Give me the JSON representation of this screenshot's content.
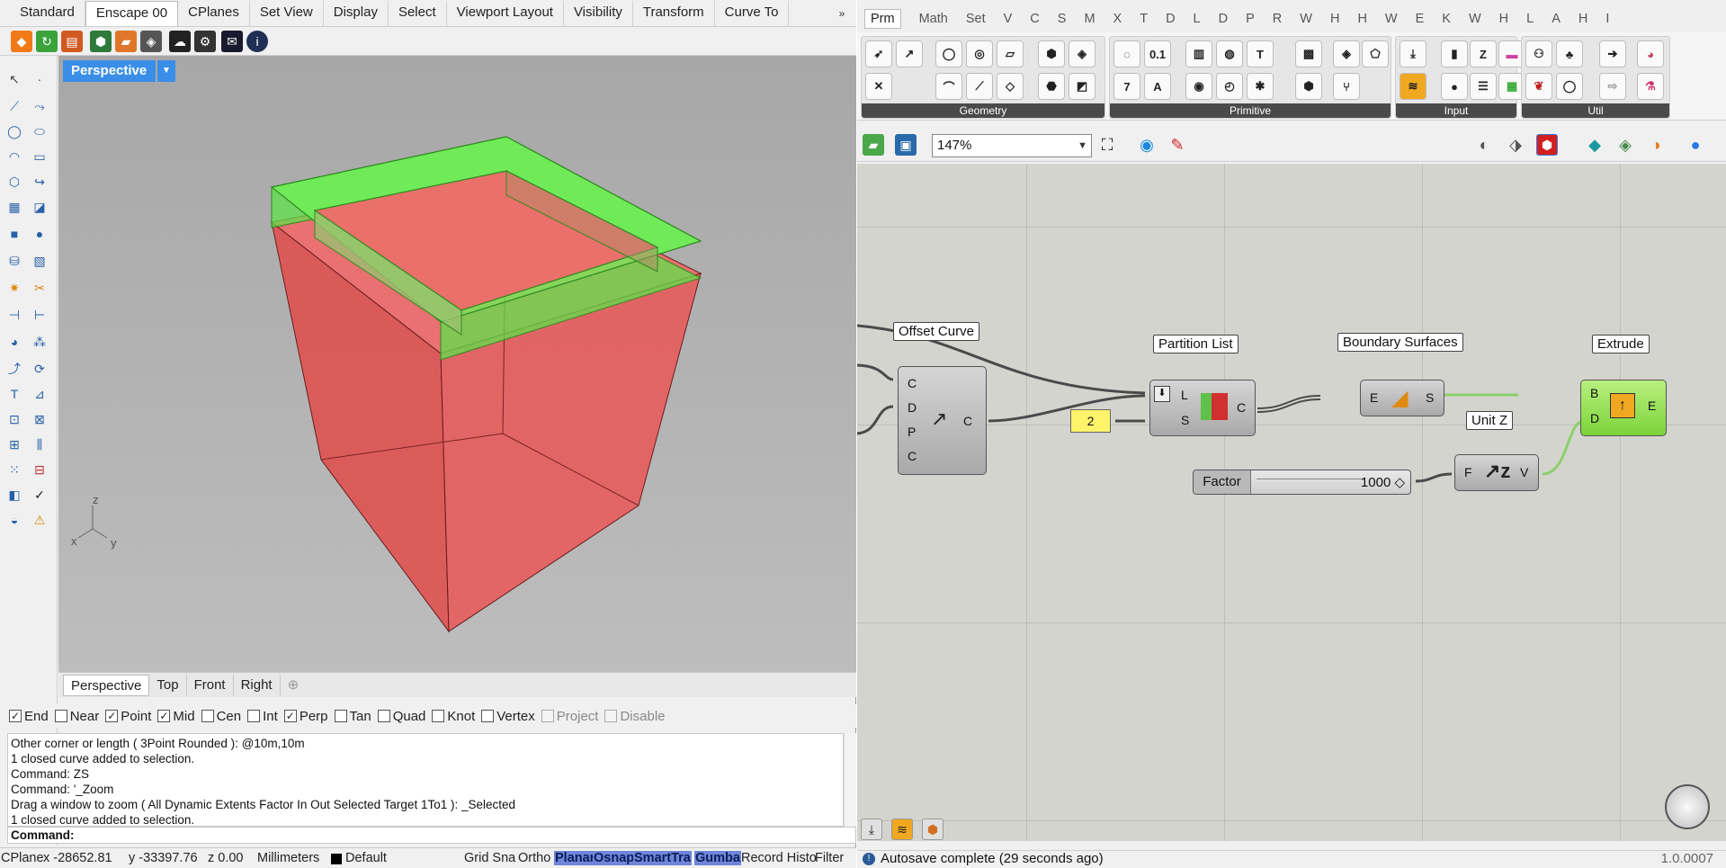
{
  "rhino": {
    "tabs": [
      "Standard",
      "Enscape 00",
      "CPlanes",
      "Set View",
      "Display",
      "Select",
      "Viewport Layout",
      "Visibility",
      "Transform",
      "Curve To"
    ],
    "active_tab": "Enscape 00",
    "viewport": {
      "title": "Perspective",
      "axis_z": "z",
      "axis_x": "x",
      "axis_y": "y"
    },
    "viewport_tabs": [
      "Perspective",
      "Top",
      "Front",
      "Right"
    ],
    "osnaps": [
      {
        "label": "End",
        "checked": true
      },
      {
        "label": "Near",
        "checked": false
      },
      {
        "label": "Point",
        "checked": true
      },
      {
        "label": "Mid",
        "checked": true
      },
      {
        "label": "Cen",
        "checked": false
      },
      {
        "label": "Int",
        "checked": false
      },
      {
        "label": "Perp",
        "checked": true
      },
      {
        "label": "Tan",
        "checked": false
      },
      {
        "label": "Quad",
        "checked": false
      },
      {
        "label": "Knot",
        "checked": false
      },
      {
        "label": "Vertex",
        "checked": false
      },
      {
        "label": "Project",
        "checked": false,
        "disabled": true
      },
      {
        "label": "Disable",
        "checked": false,
        "disabled": true
      }
    ],
    "command_history": [
      "Other corner or length ( 3Point  Rounded ): @10m,10m",
      "1 closed curve added to selection.",
      "Command: ZS",
      "Command: '_Zoom",
      "Drag a window to zoom ( All  Dynamic  Extents  Factor  In  Out  Selected  Target  1To1 ): _Selected",
      "1 closed curve added to selection."
    ],
    "command_prompt": "Command:",
    "status": {
      "cplane": "CPlane",
      "x": "x -28652.81",
      "y": "y -33397.76",
      "z": "z 0.00",
      "units": "Millimeters",
      "layer": "Default",
      "grid_snap": "Grid Sna",
      "ortho": "Ortho",
      "planar": "Planar",
      "osnap": "Osnap",
      "smarttrack": "SmartTra",
      "gumball": "Gumba",
      "record": "Record Histo",
      "filter": "Filter"
    },
    "colors": {
      "viewport_label": "#3a8ee8",
      "box_red": "#e24b4b",
      "ring_green": "#5fe24a"
    }
  },
  "gh": {
    "tabs": [
      "Prm",
      "Math",
      "Set",
      "V",
      "C",
      "S",
      "M",
      "X",
      "T",
      "D",
      "L",
      "D",
      "P",
      "R",
      "W",
      "H",
      "H",
      "W",
      "E",
      "K",
      "W",
      "H",
      "L",
      "A",
      "H",
      "I"
    ],
    "active_tab": "Prm",
    "ribbon_groups": [
      "Geometry",
      "Primitive",
      "Input",
      "Util"
    ],
    "zoom": "147%",
    "components": {
      "offset_curve": {
        "label": "Offset Curve",
        "inputs": [
          "C",
          "D",
          "P",
          "C"
        ],
        "output": "C"
      },
      "panel_value": "2",
      "partition_list": {
        "label": "Partition List",
        "inputs": [
          "L",
          "S"
        ],
        "output": "C"
      },
      "boundary_surfaces": {
        "label": "Boundary Surfaces",
        "input": "E",
        "output": "S"
      },
      "unit_z": {
        "label": "Unit Z",
        "input": "F",
        "output": "V"
      },
      "extrude": {
        "label": "Extrude",
        "inputs": [
          "B",
          "D"
        ],
        "output": "E"
      },
      "slider": {
        "label": "Factor",
        "value": "1000 ◇"
      }
    },
    "status": "Autosave complete (29 seconds ago)",
    "version": "1.0.0007"
  }
}
